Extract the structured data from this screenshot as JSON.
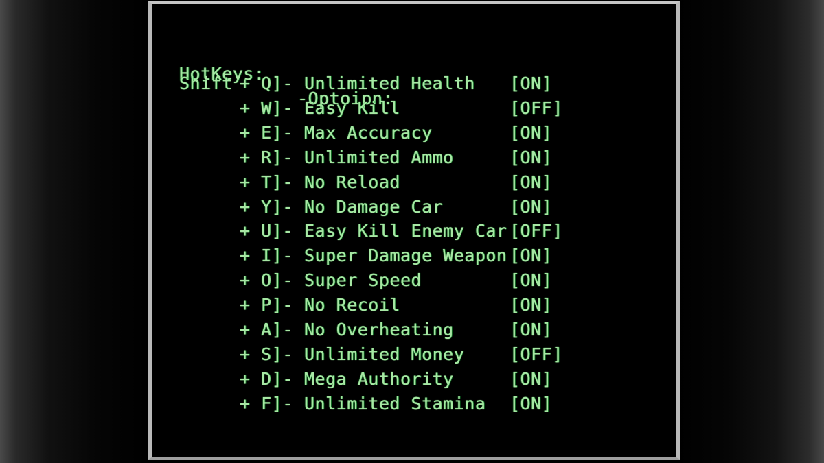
{
  "window": {
    "frame_color": "#b9b9b9",
    "background_color": "#000000",
    "text_color": "#a7e7a4"
  },
  "header": {
    "hotkeys_label": "HotKeys:",
    "options_label": "-Optoipn:"
  },
  "modifier": {
    "label": "Shift"
  },
  "states": {
    "on": "[ON]",
    "off": "[OFF]"
  },
  "rows": [
    {
      "modifier": "Shift",
      "key": "+ Q]-",
      "option": "Unlimited Health",
      "state": "[ON]"
    },
    {
      "modifier": "",
      "key": "+ W]-",
      "option": "Easy Kill",
      "state": "[OFF]"
    },
    {
      "modifier": "",
      "key": "+ E]-",
      "option": "Max Accuracy",
      "state": "[ON]"
    },
    {
      "modifier": "",
      "key": "+ R]-",
      "option": "Unlimited Ammo",
      "state": "[ON]"
    },
    {
      "modifier": "",
      "key": "+ T]-",
      "option": "No Reload",
      "state": "[ON]"
    },
    {
      "modifier": "",
      "key": "+ Y]-",
      "option": "No Damage Car",
      "state": "[ON]"
    },
    {
      "modifier": "",
      "key": "+ U]-",
      "option": "Easy Kill Enemy Car",
      "state": "[OFF]"
    },
    {
      "modifier": "",
      "key": "+ I]-",
      "option": "Super Damage Weapon",
      "state": "[ON]"
    },
    {
      "modifier": "",
      "key": "+ O]-",
      "option": "Super Speed",
      "state": "[ON]"
    },
    {
      "modifier": "",
      "key": "+ P]-",
      "option": "No Recoil",
      "state": "[ON]"
    },
    {
      "modifier": "",
      "key": "+ A]-",
      "option": "No Overheating",
      "state": "[ON]"
    },
    {
      "modifier": "",
      "key": "+ S]-",
      "option": "Unlimited Money",
      "state": "[OFF]"
    },
    {
      "modifier": "",
      "key": "+ D]-",
      "option": "Mega Authority",
      "state": "[ON]"
    },
    {
      "modifier": "",
      "key": "+ F]-",
      "option": "Unlimited Stamina",
      "state": "[ON]"
    }
  ]
}
